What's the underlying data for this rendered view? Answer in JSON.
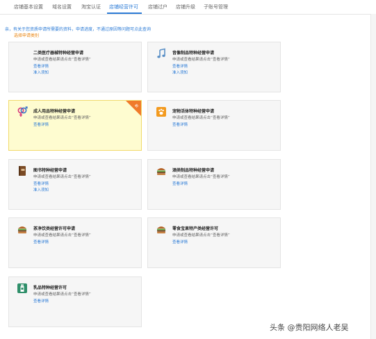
{
  "tabs": [
    {
      "label": "店铺基本设置",
      "active": false
    },
    {
      "label": "域名设置",
      "active": false
    },
    {
      "label": "淘宝认证",
      "active": false
    },
    {
      "label": "店铺经营许可",
      "active": true
    },
    {
      "label": "店铺过户",
      "active": false
    },
    {
      "label": "店铺升级",
      "active": false
    },
    {
      "label": "子账号管理",
      "active": false
    }
  ],
  "notice": "亲，有关于您资质申请所需要的资料，申请进度，不通过原因等问题可点此查询",
  "section_title": "选择申请类别",
  "cards": [
    {
      "title": "二类医疗器械特种经营申请",
      "subtitle": "申请或查看结果请点击“查看详情”",
      "link1": "查看详情",
      "link2": "准入须知",
      "icon": "medical-device-icon"
    },
    {
      "title": "音像制品特种经营申请",
      "subtitle": "申请或查看结果请点击“查看详情”",
      "link1": "查看详情",
      "link2": "准入须知",
      "icon": "music-note-icon"
    },
    {
      "title": "成人用品特种经营申请",
      "subtitle": "申请或查看结果请点击“查看详情”",
      "link1": "查看详情",
      "link2": "",
      "icon": "gender-symbol-icon",
      "highlight": true,
      "badge": "new"
    },
    {
      "title": "宠物活体特种经营申请",
      "subtitle": "申请或查看结果请点击“查看详情”",
      "link1": "查看详情",
      "link2": "",
      "icon": "paw-icon"
    },
    {
      "title": "图书特种经营申请",
      "subtitle": "申请或查看结果请点击“查看详情”",
      "link1": "查看详情",
      "link2": "准入须知",
      "icon": "book-icon"
    },
    {
      "title": "酒类制品特种经营申请",
      "subtitle": "申请或查看结果请点击“查看详情”",
      "link1": "查看详情",
      "link2": "",
      "icon": "burger-icon"
    },
    {
      "title": "茶净饮类经营许可申请",
      "subtitle": "申请或查看结果请点击“查看详情”",
      "link1": "查看详情",
      "link2": "",
      "icon": "burger-icon"
    },
    {
      "title": "零食宝果特产类经营许可",
      "subtitle": "申请或查看结果请点击“查看详情”",
      "link1": "查看详情",
      "link2": "",
      "icon": "burger-icon"
    },
    {
      "title": "乳品特种经营许可",
      "subtitle": "申请或查看结果请点击“查看详情”",
      "link1": "查看详情",
      "link2": "",
      "icon": "milk-bottle-icon"
    }
  ],
  "watermark": "头条 @贵阳网络人老吴",
  "colors": {
    "link": "#2b7bd6",
    "accent": "#e8820c",
    "highlight_bg": "#fefcd0",
    "badge": "#f07b2a"
  }
}
